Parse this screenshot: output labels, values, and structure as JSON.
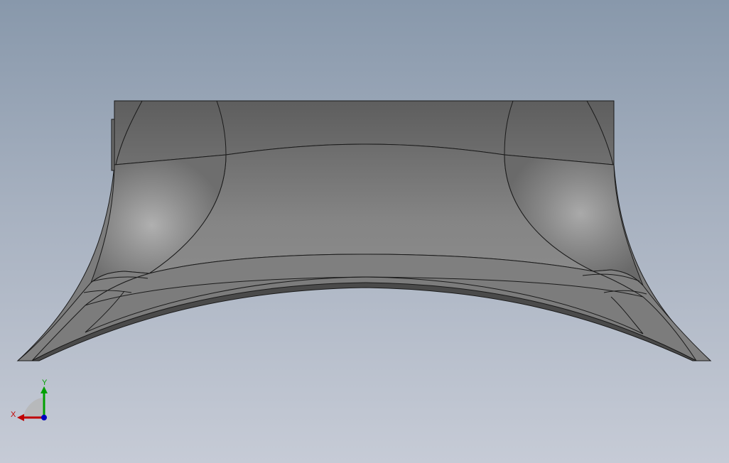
{
  "viewport": {
    "background_top": "#8898ab",
    "background_bottom": "#c6cbd6",
    "model_color": "#7a7a7a",
    "edge_color": "#1a1a1a"
  },
  "triad": {
    "x_label": "X",
    "y_label": "Y",
    "x_color": "#c00000",
    "y_color": "#00a000",
    "z_color": "#0000c0"
  }
}
